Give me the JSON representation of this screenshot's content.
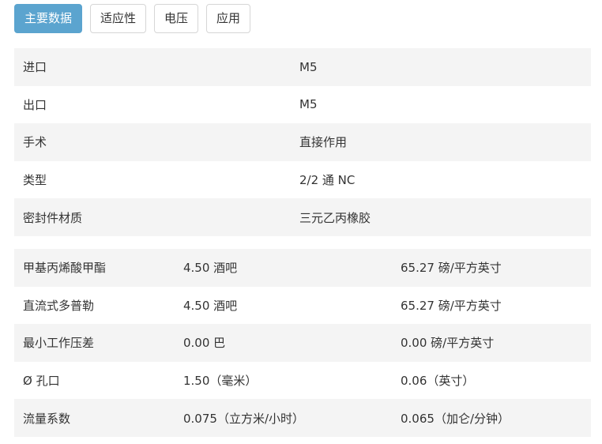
{
  "tabs": [
    {
      "label": "主要数据",
      "active": true
    },
    {
      "label": "适应性",
      "active": false
    },
    {
      "label": "电压",
      "active": false
    },
    {
      "label": "应用",
      "active": false
    }
  ],
  "specs": [
    {
      "label": "进口",
      "value": "M5"
    },
    {
      "label": "出口",
      "value": "M5"
    },
    {
      "label": "手术",
      "value": "直接作用"
    },
    {
      "label": "类型",
      "value": "2/2 通 NC"
    },
    {
      "label": "密封件材质",
      "value": "三元乙丙橡胶"
    }
  ],
  "ratings": [
    {
      "label": "甲基丙烯酸甲酯",
      "metric": "4.50 酒吧",
      "imperial": "65.27 磅/平方英寸"
    },
    {
      "label": "直流式多普勒",
      "metric": "4.50 酒吧",
      "imperial": "65.27 磅/平方英寸"
    },
    {
      "label": "最小工作压差",
      "metric": "0.00 巴",
      "imperial": "0.00 磅/平方英寸"
    },
    {
      "label": "Ø 孔口",
      "metric": "1.50（毫米）",
      "imperial": "0.06（英寸）"
    },
    {
      "label": "流量系数",
      "metric": "0.075（立方米/小时）",
      "imperial": "0.065（加仑/分钟）"
    }
  ],
  "colors": {
    "active_tab": "#5ba4cf",
    "row_stripe": "#f4f4f4"
  }
}
